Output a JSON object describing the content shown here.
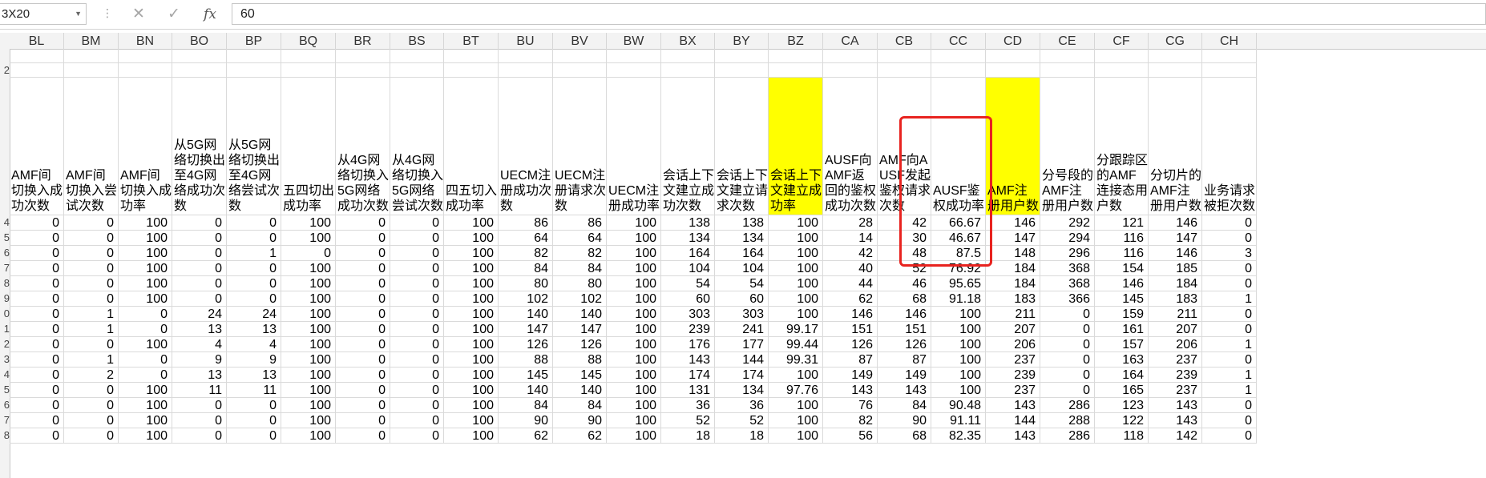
{
  "formula_bar": {
    "name_box": "3X20",
    "fx_label": "fx",
    "formula_value": "60"
  },
  "columns": [
    {
      "letter": "BL",
      "header": "AMF间切换入成功次数"
    },
    {
      "letter": "BM",
      "header": "AMF间切换入尝试次数"
    },
    {
      "letter": "BN",
      "header": "AMF间切换入成功率"
    },
    {
      "letter": "BO",
      "header": "从5G网络切换出至4G网络成功次数"
    },
    {
      "letter": "BP",
      "header": "从5G网络切换出至4G网络尝试次数"
    },
    {
      "letter": "BQ",
      "header": "五四切出成功率"
    },
    {
      "letter": "BR",
      "header": "从4G网络切换入5G网络成功次数"
    },
    {
      "letter": "BS",
      "header": "从4G网络切换入5G网络尝试次数"
    },
    {
      "letter": "BT",
      "header": "四五切入成功率"
    },
    {
      "letter": "BU",
      "header": "UECM注册成功次数"
    },
    {
      "letter": "BV",
      "header": "UECM注册请求次数"
    },
    {
      "letter": "BW",
      "header": "UECM注册成功率"
    },
    {
      "letter": "BX",
      "header": "会话上下文建立成功次数"
    },
    {
      "letter": "BY",
      "header": "会话上下文建立请求次数"
    },
    {
      "letter": "BZ",
      "header": "会话上下文建立成功率"
    },
    {
      "letter": "CA",
      "header": "AUSF向AMF返回的鉴权成功次数"
    },
    {
      "letter": "CB",
      "header": "AMF向AUSF发起鉴权请求次数"
    },
    {
      "letter": "CC",
      "header": "AUSF鉴权成功率"
    },
    {
      "letter": "CD",
      "header": "AMF注册用户数"
    },
    {
      "letter": "CE",
      "header": "分号段的AMF注册用户数"
    },
    {
      "letter": "CF",
      "header": "分跟踪区的AMF连接态用户数"
    },
    {
      "letter": "CG",
      "header": "分切片的AMF注册用户数"
    },
    {
      "letter": "CH",
      "header": "业务请求被拒次数"
    }
  ],
  "row_numbers": [
    "",
    "2",
    "",
    "4",
    "5",
    "6",
    "7",
    "8",
    "9",
    "0",
    "1",
    "2",
    "3",
    "4",
    "5",
    "6",
    "7",
    "8"
  ],
  "rows": [
    [
      "0",
      "0",
      "100",
      "0",
      "0",
      "100",
      "0",
      "0",
      "100",
      "86",
      "86",
      "100",
      "138",
      "138",
      "100",
      "28",
      "42",
      "66.67",
      "146",
      "292",
      "121",
      "146",
      "0"
    ],
    [
      "0",
      "0",
      "100",
      "0",
      "0",
      "100",
      "0",
      "0",
      "100",
      "64",
      "64",
      "100",
      "134",
      "134",
      "100",
      "14",
      "30",
      "46.67",
      "147",
      "294",
      "116",
      "147",
      "0"
    ],
    [
      "0",
      "0",
      "100",
      "0",
      "1",
      "0",
      "0",
      "0",
      "100",
      "82",
      "82",
      "100",
      "164",
      "164",
      "100",
      "42",
      "48",
      "87.5",
      "148",
      "296",
      "116",
      "146",
      "3"
    ],
    [
      "0",
      "0",
      "100",
      "0",
      "0",
      "100",
      "0",
      "0",
      "100",
      "84",
      "84",
      "100",
      "104",
      "104",
      "100",
      "40",
      "52",
      "76.92",
      "184",
      "368",
      "154",
      "185",
      "0"
    ],
    [
      "0",
      "0",
      "100",
      "0",
      "0",
      "100",
      "0",
      "0",
      "100",
      "80",
      "80",
      "100",
      "54",
      "54",
      "100",
      "44",
      "46",
      "95.65",
      "184",
      "368",
      "146",
      "184",
      "0"
    ],
    [
      "0",
      "0",
      "100",
      "0",
      "0",
      "100",
      "0",
      "0",
      "100",
      "102",
      "102",
      "100",
      "60",
      "60",
      "100",
      "62",
      "68",
      "91.18",
      "183",
      "366",
      "145",
      "183",
      "1"
    ],
    [
      "0",
      "1",
      "0",
      "24",
      "24",
      "100",
      "0",
      "0",
      "100",
      "140",
      "140",
      "100",
      "303",
      "303",
      "100",
      "146",
      "146",
      "100",
      "211",
      "0",
      "159",
      "211",
      "0"
    ],
    [
      "0",
      "1",
      "0",
      "13",
      "13",
      "100",
      "0",
      "0",
      "100",
      "147",
      "147",
      "100",
      "239",
      "241",
      "99.17",
      "151",
      "151",
      "100",
      "207",
      "0",
      "161",
      "207",
      "0"
    ],
    [
      "0",
      "0",
      "100",
      "4",
      "4",
      "100",
      "0",
      "0",
      "100",
      "126",
      "126",
      "100",
      "176",
      "177",
      "99.44",
      "126",
      "126",
      "100",
      "206",
      "0",
      "157",
      "206",
      "1"
    ],
    [
      "0",
      "1",
      "0",
      "9",
      "9",
      "100",
      "0",
      "0",
      "100",
      "88",
      "88",
      "100",
      "143",
      "144",
      "99.31",
      "87",
      "87",
      "100",
      "237",
      "0",
      "163",
      "237",
      "0"
    ],
    [
      "0",
      "2",
      "0",
      "13",
      "13",
      "100",
      "0",
      "0",
      "100",
      "145",
      "145",
      "100",
      "174",
      "174",
      "100",
      "149",
      "149",
      "100",
      "239",
      "0",
      "164",
      "239",
      "1"
    ],
    [
      "0",
      "0",
      "100",
      "11",
      "11",
      "100",
      "0",
      "0",
      "100",
      "140",
      "140",
      "100",
      "131",
      "134",
      "97.76",
      "143",
      "143",
      "100",
      "237",
      "0",
      "165",
      "237",
      "1"
    ],
    [
      "0",
      "0",
      "100",
      "0",
      "0",
      "100",
      "0",
      "0",
      "100",
      "84",
      "84",
      "100",
      "36",
      "36",
      "100",
      "76",
      "84",
      "90.48",
      "143",
      "286",
      "123",
      "143",
      "0"
    ],
    [
      "0",
      "0",
      "100",
      "0",
      "0",
      "100",
      "0",
      "0",
      "100",
      "90",
      "90",
      "100",
      "52",
      "52",
      "100",
      "82",
      "90",
      "91.11",
      "144",
      "288",
      "122",
      "143",
      "0"
    ],
    [
      "0",
      "0",
      "100",
      "0",
      "0",
      "100",
      "0",
      "0",
      "100",
      "62",
      "62",
      "100",
      "18",
      "18",
      "100",
      "56",
      "68",
      "82.35",
      "143",
      "286",
      "118",
      "142",
      "0"
    ]
  ],
  "highlight_color": "#ffff00",
  "callout_color": "#e8231f"
}
